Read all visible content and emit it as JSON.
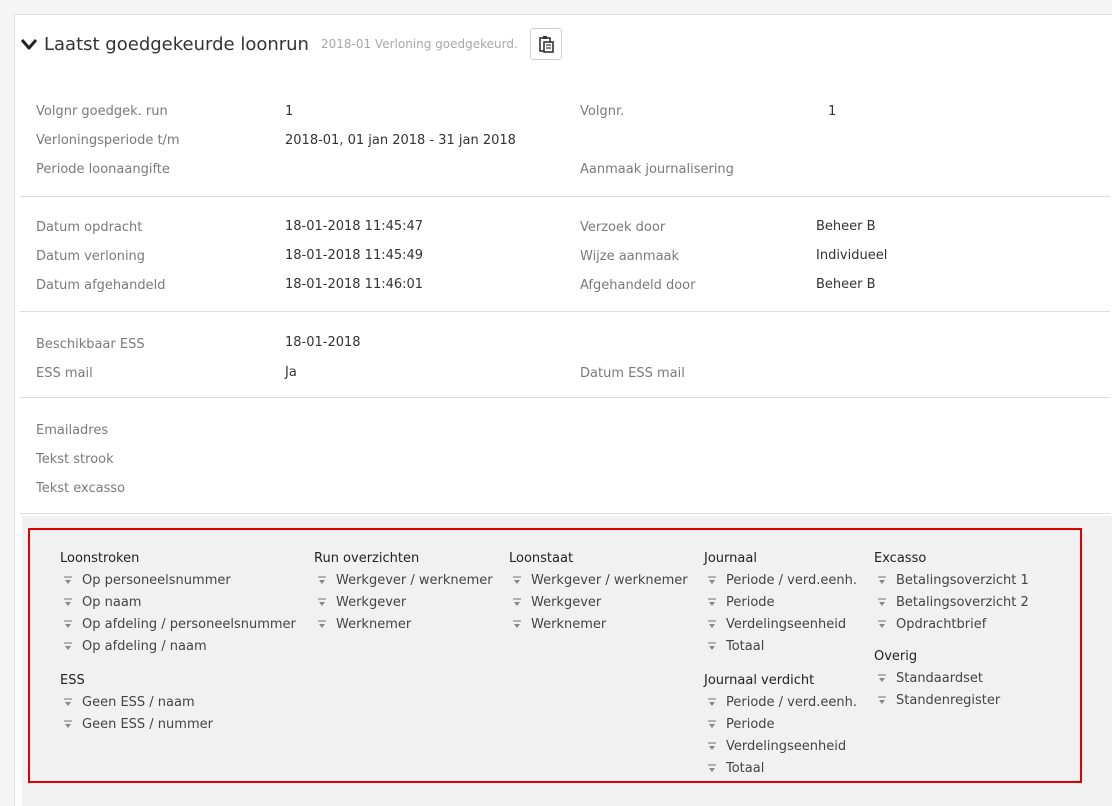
{
  "header": {
    "title": "Laatst goedgekeurde loonrun",
    "subtitle": "2018-01 Verloning goedgekeurd."
  },
  "info": {
    "volgnr_goedgek_label": "Volgnr goedgek. run",
    "volgnr_goedgek_value": "1",
    "volgnr_label": "Volgnr.",
    "volgnr_value": "1",
    "verloningsperiode_label": "Verloningsperiode t/m",
    "verloningsperiode_value": "2018-01, 01 jan 2018 - 31 jan 2018",
    "periode_loonaangifte_label": "Periode loonaangifte",
    "aanmaak_journalisering_label": "Aanmaak journalisering",
    "datum_opdracht_label": "Datum opdracht",
    "datum_opdracht_value": "18-01-2018 11:45:47",
    "verzoek_door_label": "Verzoek door",
    "verzoek_door_value": "Beheer B",
    "datum_verloning_label": "Datum verloning",
    "datum_verloning_value": "18-01-2018 11:45:49",
    "wijze_aanmaak_label": "Wijze aanmaak",
    "wijze_aanmaak_value": "Individueel",
    "datum_afgehandeld_label": "Datum afgehandeld",
    "datum_afgehandeld_value": "18-01-2018 11:46:01",
    "afgehandeld_door_label": "Afgehandeld door",
    "afgehandeld_door_value": "Beheer B",
    "beschikbaar_ess_label": "Beschikbaar ESS",
    "beschikbaar_ess_value": "18-01-2018",
    "ess_mail_label": "ESS mail",
    "ess_mail_value": "Ja",
    "datum_ess_mail_label": "Datum ESS mail",
    "emailadres_label": "Emailadres",
    "tekst_strook_label": "Tekst strook",
    "tekst_excasso_label": "Tekst excasso"
  },
  "reports": {
    "loonstroken": {
      "title": "Loonstroken",
      "items": [
        "Op personeelsnummer",
        "Op naam",
        "Op afdeling / personeelsnummer",
        "Op afdeling / naam"
      ]
    },
    "ess": {
      "title": "ESS",
      "items": [
        "Geen ESS / naam",
        "Geen ESS / nummer"
      ]
    },
    "run_overzichten": {
      "title": "Run overzichten",
      "items": [
        "Werkgever / werknemer",
        "Werkgever",
        "Werknemer"
      ]
    },
    "loonstaat": {
      "title": "Loonstaat",
      "items": [
        "Werkgever / werknemer",
        "Werkgever",
        "Werknemer"
      ]
    },
    "journaal": {
      "title": "Journaal",
      "items": [
        "Periode / verd.eenh.",
        "Periode",
        "Verdelingseenheid",
        "Totaal"
      ]
    },
    "journaal_verdicht": {
      "title": "Journaal verdicht",
      "items": [
        "Periode / verd.eenh.",
        "Periode",
        "Verdelingseenheid",
        "Totaal"
      ]
    },
    "excasso": {
      "title": "Excasso",
      "items": [
        "Betalingsoverzicht 1",
        "Betalingsoverzicht 2",
        "Opdrachtbrief"
      ]
    },
    "overig": {
      "title": "Overig",
      "items": [
        "Standaardset",
        "Standenregister"
      ]
    }
  }
}
